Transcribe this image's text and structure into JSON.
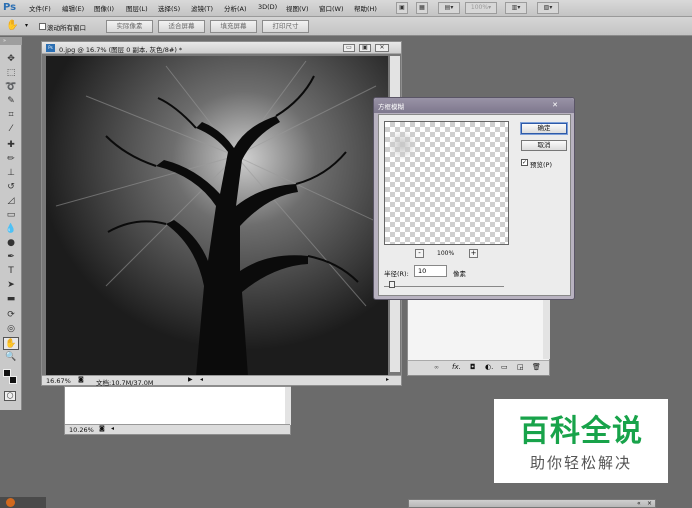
{
  "app": {
    "logo": "Ps"
  },
  "menu": {
    "items": [
      "文件(F)",
      "编辑(E)",
      "图像(I)",
      "图层(L)",
      "选择(S)",
      "滤镜(T)",
      "分析(A)",
      "3D(D)",
      "视图(V)",
      "窗口(W)",
      "帮助(H)"
    ],
    "zoom_readout": "100%"
  },
  "options": {
    "scroll_all_label": "滚动所有窗口",
    "buttons": [
      "实际像素",
      "适合屏幕",
      "填充屏幕",
      "打印尺寸"
    ]
  },
  "doc_main": {
    "title": "0.jpg @ 16.7% (图层 0 副本, 灰色/8#) *",
    "zoom": "16.67%",
    "doc_size": "文档:10.7M/37.0M"
  },
  "doc_back": {
    "zoom": "10.26%"
  },
  "dialog": {
    "title": "方框模糊",
    "ok_label": "确定",
    "cancel_label": "取消",
    "preview_label": "预览(P)",
    "preview_checked": true,
    "zoom_out": "-",
    "zoom_in": "+",
    "zoom_percent": "100%",
    "radius_label": "半径(R):",
    "radius_value": "10",
    "unit_label": "像素"
  },
  "watermark": {
    "title": "百科全说",
    "subtitle": "助你轻松解决"
  },
  "colors": {
    "wm_green": "#18a34a",
    "canvas": "#1c1c1c",
    "dialog_frame": "#7e778d"
  }
}
